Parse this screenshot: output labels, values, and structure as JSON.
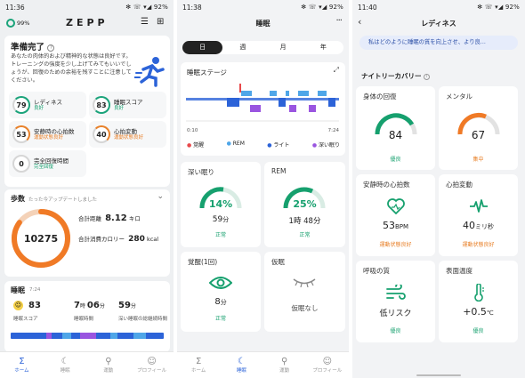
{
  "screen1": {
    "status": {
      "time": "11:36",
      "right": "✻ ☏ ▾◢ 92%"
    },
    "header": {
      "battery_pct": "99%",
      "logo": "ZEPP"
    },
    "readiness": {
      "title": "準備完了",
      "description": "あなたの肉体的および精神的な状態は良好です。トレーニングの強度を少し上げてみてもいいでしょうが、回復のための余裕を残すことに注意してください。",
      "metrics": [
        {
          "value": "79",
          "label": "レディネス",
          "status": "良好"
        },
        {
          "value": "83",
          "label": "睡眠スコア",
          "status": "良好"
        },
        {
          "value": "53",
          "label": "安静時の心拍数",
          "status": "運動状態良好"
        },
        {
          "value": "40",
          "label": "心拍変動",
          "status": "運動状態良好"
        },
        {
          "value": "0",
          "label": "完全回復時間",
          "status": "完全回復"
        }
      ]
    },
    "steps": {
      "title": "歩数",
      "subtitle": "たった今アップデートしました",
      "count": "10275",
      "distance_label": "合計距離",
      "distance_value": "8.12",
      "distance_unit": "キロ",
      "calorie_label": "合計消費カロリー",
      "calorie_value": "280",
      "calorie_unit": "kcal",
      "progress": 0.85
    },
    "sleep": {
      "title": "睡眠",
      "time": "7:24",
      "score": "83",
      "score_label": "睡眠スコア",
      "duration_h": "7",
      "duration_h_unit": "時",
      "duration_m": "06",
      "duration_m_unit": "分",
      "duration_label": "睡眠時間",
      "deep_value": "59",
      "deep_unit": "分",
      "deep_label": "深い睡眠の総継続時間"
    },
    "tabs": [
      {
        "label": "ホーム",
        "icon": "Σ"
      },
      {
        "label": "睡眠",
        "icon": "☾"
      },
      {
        "label": "運動",
        "icon": "⚲"
      },
      {
        "label": "プロフィール",
        "icon": "☺"
      }
    ]
  },
  "screen2": {
    "status": {
      "time": "11:38",
      "right": "✻ ☏ ▾◢ 92%"
    },
    "title": "睡眠",
    "period_tabs": [
      "日",
      "週",
      "月",
      "年"
    ],
    "stage": {
      "title": "睡眠ステージ",
      "start": "0:10",
      "end": "7:24",
      "legend": [
        {
          "label": "覚醒",
          "color": "#e8494b"
        },
        {
          "label": "REM",
          "color": "#4fa6e8"
        },
        {
          "label": "ライト",
          "color": "#2c63d8"
        },
        {
          "label": "深い眠り",
          "color": "#9a55e0"
        }
      ]
    },
    "deep": {
      "title": "深い眠り",
      "pct": "14%",
      "pct_value": 0.14,
      "value": "59",
      "unit": "分",
      "status": "正常"
    },
    "rem": {
      "title": "REM",
      "pct": "25%",
      "pct_value": 0.25,
      "value": "1時 48分",
      "status": "正常"
    },
    "wake": {
      "title": "覚醒(1回)",
      "value": "8",
      "unit": "分",
      "status": "正常"
    },
    "nap": {
      "title": "仮眠",
      "value": "仮眠なし"
    },
    "tabs": [
      {
        "label": "ホーム",
        "icon": "Σ"
      },
      {
        "label": "睡眠",
        "icon": "☾"
      },
      {
        "label": "運動",
        "icon": "⚲"
      },
      {
        "label": "プロフィール",
        "icon": "☺"
      }
    ]
  },
  "screen3": {
    "status": {
      "time": "11:40",
      "right": "✻ ☏ ▾◢ 92%"
    },
    "title": "レディネス",
    "banner": "私はどのように睡眠の質を向上させ、より良...",
    "section_title": "ナイトリーカバリー",
    "tiles": [
      {
        "title": "身体の回復",
        "value": "84",
        "status": "優良",
        "level": 0.84
      },
      {
        "title": "メンタル",
        "value": "67",
        "status": "集中",
        "level": 0.67
      },
      {
        "title": "安静時の心拍数",
        "value": "53",
        "unit": "BPM",
        "status": "運動状態良好"
      },
      {
        "title": "心拍変動",
        "value": "40",
        "unit": "ミリ秒",
        "status": "運動状態良好"
      },
      {
        "title": "呼吸の質",
        "value": "低リスク",
        "status": "優良"
      },
      {
        "title": "表面温度",
        "value": "+0.5",
        "unit": "℃",
        "status": "優良"
      }
    ]
  }
}
